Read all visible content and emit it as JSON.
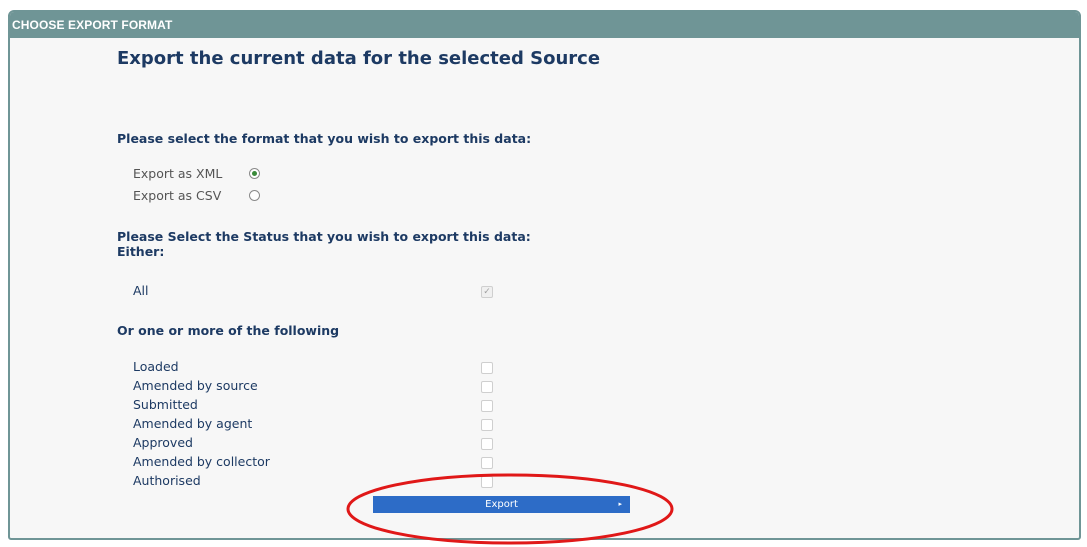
{
  "panel": {
    "header": "CHOOSE EXPORT FORMAT",
    "title": "Export the current data for the selected Source",
    "format_prompt": "Please select the format that you wish to export this data:",
    "formats": [
      {
        "label": "Export as XML",
        "selected": true
      },
      {
        "label": "Export as CSV",
        "selected": false
      }
    ],
    "status_prompt": "Please Select the Status that you wish to export this data:",
    "either_label": "Either:",
    "all_option": {
      "label": "All",
      "checked": true
    },
    "or_label": "Or one or more of the following",
    "statuses": [
      {
        "label": "Loaded",
        "checked": false
      },
      {
        "label": "Amended by source",
        "checked": false
      },
      {
        "label": "Submitted",
        "checked": false
      },
      {
        "label": "Amended by agent",
        "checked": false
      },
      {
        "label": "Approved",
        "checked": false
      },
      {
        "label": "Amended by collector",
        "checked": false
      },
      {
        "label": "Authorised",
        "checked": false
      }
    ],
    "export_button": "Export"
  },
  "colors": {
    "header_bg": "#6f9596",
    "heading_text": "#1d3a63",
    "button_bg": "#2d6cc7",
    "annotation_circle": "#e01818"
  }
}
